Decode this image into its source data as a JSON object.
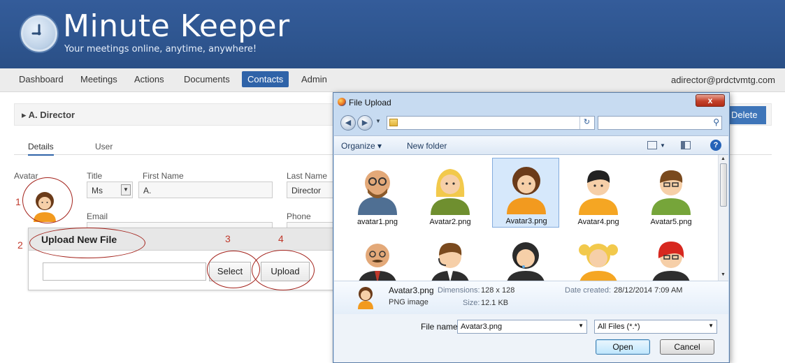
{
  "app": {
    "brand": "Minute Keeper",
    "tagline": "Your meetings online, anytime, anywhere!",
    "user_email": "adirector@prdctvmtg.com"
  },
  "nav": {
    "items": [
      {
        "label": "Dashboard",
        "active": false
      },
      {
        "label": "Meetings",
        "active": false
      },
      {
        "label": "Actions",
        "active": false
      },
      {
        "label": "Documents",
        "active": false
      },
      {
        "label": "Contacts",
        "active": true
      },
      {
        "label": "Admin",
        "active": false
      }
    ]
  },
  "contact": {
    "header": "▸ A. Director",
    "delete_label": "Delete",
    "tabs": [
      "Details",
      "User"
    ],
    "avatar_label": "Avatar",
    "title_label": "Title",
    "title_value": "Ms",
    "first_name_label": "First Name",
    "first_name_value": "A.",
    "last_name_label": "Last Name",
    "last_name_value": "Director",
    "email_label": "Email",
    "phone_label": "Phone"
  },
  "upload": {
    "title": "Upload New File",
    "select_label": "Select",
    "upload_label": "Upload"
  },
  "annotations": [
    "1",
    "2",
    "3",
    "4"
  ],
  "dialog": {
    "title": "File Upload",
    "close": "x",
    "organize": "Organize ▾",
    "new_folder": "New folder",
    "files": [
      {
        "name": "avatar1.png",
        "icon": "avatar-bald-glasses-icon",
        "selected": false
      },
      {
        "name": "Avatar2.png",
        "icon": "avatar-blonde-woman-icon",
        "selected": false
      },
      {
        "name": "Avatar3.png",
        "icon": "avatar-curly-woman-icon",
        "selected": true
      },
      {
        "name": "Avatar4.png",
        "icon": "avatar-dark-hair-man-icon",
        "selected": false
      },
      {
        "name": "Avatar5.png",
        "icon": "avatar-glasses-man-icon",
        "selected": false
      },
      {
        "name": "",
        "icon": "avatar-bald-mustache-icon",
        "selected": false
      },
      {
        "name": "",
        "icon": "avatar-headset-man-icon",
        "selected": false
      },
      {
        "name": "",
        "icon": "avatar-headset-woman-icon",
        "selected": false
      },
      {
        "name": "",
        "icon": "avatar-pigtails-girl-icon",
        "selected": false
      },
      {
        "name": "",
        "icon": "avatar-red-hair-icon",
        "selected": false
      }
    ],
    "details": {
      "name": "Avatar3.png",
      "type": "PNG image",
      "dimensions_label": "Dimensions:",
      "dimensions_value": "128 x 128",
      "size_label": "Size:",
      "size_value": "12.1 KB",
      "date_label": "Date created:",
      "date_value": "28/12/2014 7:09 AM"
    },
    "file_name_label": "File name:",
    "file_name_value": "Avatar3.png",
    "filter_value": "All Files (*.*)",
    "open_label": "Open",
    "cancel_label": "Cancel"
  },
  "colors": {
    "header_blue": "#2e558f",
    "nav_active": "#2f63a8",
    "annotation_red": "#a3221b",
    "dialog_frame": "#c7dbf1"
  }
}
